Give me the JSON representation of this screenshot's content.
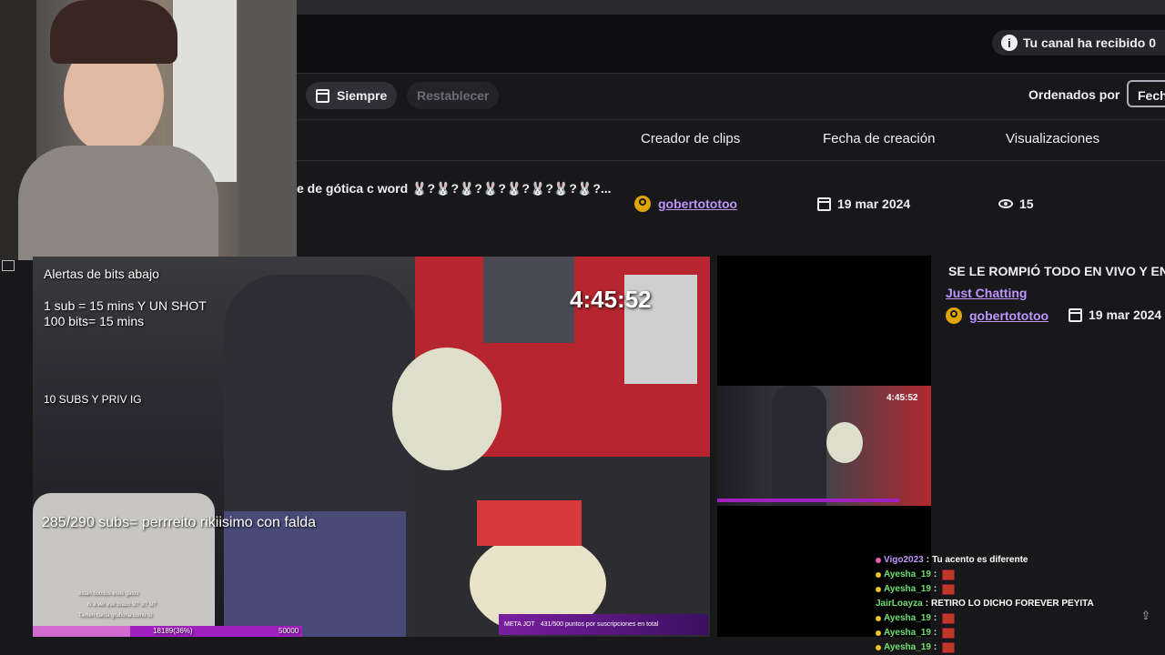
{
  "header": {
    "notice_text": "Tu canal ha recibido 0",
    "info_icon": "i"
  },
  "filters": {
    "always_label": "Siempre",
    "reset_label": "Restablecer",
    "sort_label": "Ordenados por",
    "sort_value": "Fech"
  },
  "table": {
    "columns": [
      "Creador de clips",
      "Fecha de creación",
      "Visualizaciones"
    ],
    "row": {
      "title": "e de gótica c word 🐰?🐰?🐰?🐰?🐰?🐰?🐰?🐰?...",
      "creator": "gobertototoo",
      "date": "19 mar 2024",
      "views": "15"
    }
  },
  "stream_overlay": {
    "alerts_title": "Alertas de bits abajo",
    "line1": "1 sub = 15 mins Y UN SHOT",
    "line2": "100 bits= 15 mins",
    "line3": "10 SUBS Y PRIV IG",
    "line4": "285/290 subs= perrreito rikiisimo con falda",
    "timer": "4:45:52",
    "bar_left": "18189(36%)",
    "bar_right": "50000",
    "bar_progress": 0.36,
    "goal_label": "META JOT",
    "goal_text": "431/500 puntos por suscripciones en total",
    "overlay_chat": [
      "están bonitos esos gatos",
      "is a ver ese brazo si? si? si?",
      "Tienen carita gruñona como tú"
    ]
  },
  "clip_detail": {
    "title": "SE LE ROMPIÓ TODO EN VIVO Y EN",
    "category": "Just Chatting",
    "creator": "gobertototoo",
    "date": "19 mar 2024",
    "mini_timer": "4:45:52"
  },
  "chat": [
    {
      "user": "Vigo2023",
      "message": "Tu acento es diferente",
      "color": "#bf94ff",
      "emote": false,
      "badge": "pink"
    },
    {
      "user": "Ayesha_19",
      "message": "",
      "color": "#6ee06e",
      "emote": true,
      "badge": "yellow"
    },
    {
      "user": "Ayesha_19",
      "message": "",
      "color": "#6ee06e",
      "emote": true,
      "badge": "yellow"
    },
    {
      "user": "JairLoayza",
      "message": "RETIRO LO DICHO FOREVER PEYITA",
      "color": "#6ee06e",
      "emote": false,
      "badge": ""
    },
    {
      "user": "Ayesha_19",
      "message": "",
      "color": "#6ee06e",
      "emote": true,
      "badge": "yellow"
    },
    {
      "user": "Ayesha_19",
      "message": "",
      "color": "#6ee06e",
      "emote": true,
      "badge": "yellow"
    },
    {
      "user": "Ayesha_19",
      "message": "",
      "color": "#6ee06e",
      "emote": true,
      "badge": "yellow"
    }
  ],
  "colors": {
    "accent": "#bf94ff",
    "background": "#18181b",
    "goal_bar": "#a020c0"
  },
  "icons": [
    "info-icon",
    "calendar-icon",
    "user-icon",
    "eye-icon",
    "share-icon"
  ]
}
